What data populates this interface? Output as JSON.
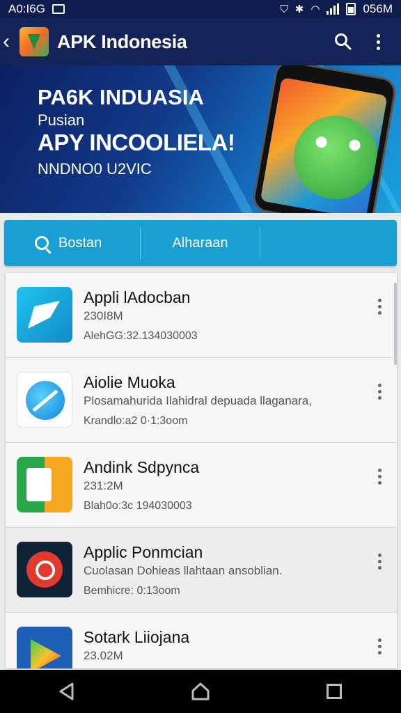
{
  "status_bar": {
    "time": "A0:I6G",
    "clock": "056M"
  },
  "app_bar": {
    "title": "APK Indonesia"
  },
  "banner": {
    "line1": "PA6K INDUASIA",
    "line2": "Pusian",
    "line3": "APY INCOOLIELA!",
    "line4": "NNDNO0 U2VIC"
  },
  "search_bar": {
    "search_label": "Bostan",
    "tab_label": "Alharaan"
  },
  "apps": [
    {
      "title": "Appli lAdocban",
      "subtitle": "230I8M",
      "meta": "AlehGG:32.134030003",
      "icon": "paper-plane-icon"
    },
    {
      "title": "Aiolie Muoka",
      "subtitle": "Plosamahurida Ilahidral depuada llaganara,",
      "meta": "Krandlo:a2 0·1:3oom",
      "icon": "compass-icon"
    },
    {
      "title": "Andink Sdpynca",
      "subtitle": "231:2M",
      "meta": "Blah0o:3c 194030003",
      "icon": "arrow-app-icon"
    },
    {
      "title": "Applic Ponmcian",
      "subtitle": "Cuolasan Dohieas llahtaan ansoblian.",
      "meta": "Bemhicre: 0:13oom",
      "icon": "target-icon"
    },
    {
      "title": "Sotark Liiojana",
      "subtitle": "23.02M",
      "meta": "",
      "icon": "play-store-icon"
    }
  ],
  "colors": {
    "app_bar": "#142458",
    "accent": "#1a9fd3",
    "nav": "#000000"
  }
}
